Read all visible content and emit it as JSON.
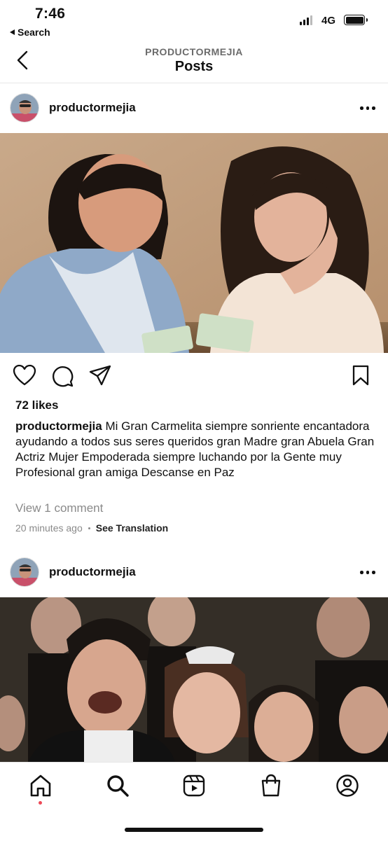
{
  "status_bar": {
    "time": "7:46",
    "back_label": "Search",
    "network": "4G"
  },
  "header": {
    "account": "PRODUCTORMEJIA",
    "title": "Posts"
  },
  "posts": [
    {
      "username": "productormejia",
      "likes": "72 likes",
      "caption_username": "productormejia",
      "caption_text": "Mi Gran Carmelita siempre sonriente encantadora ayudando a todos sus seres queridos gran Madre gran Abuela Gran Actriz Mujer Empoderada siempre luchando por la Gente muy Profesional gran amiga Descanse en Paz",
      "view_comments": "View 1 comment",
      "time_ago": "20 minutes ago",
      "see_translation": "See Translation"
    },
    {
      "username": "productormejia"
    }
  ],
  "tab_bar": [
    "home-icon",
    "search-icon",
    "reels-icon",
    "shop-icon",
    "profile-icon"
  ],
  "colors": {
    "notification_dot": "#ed4956",
    "muted_text": "#8a8a8a"
  }
}
